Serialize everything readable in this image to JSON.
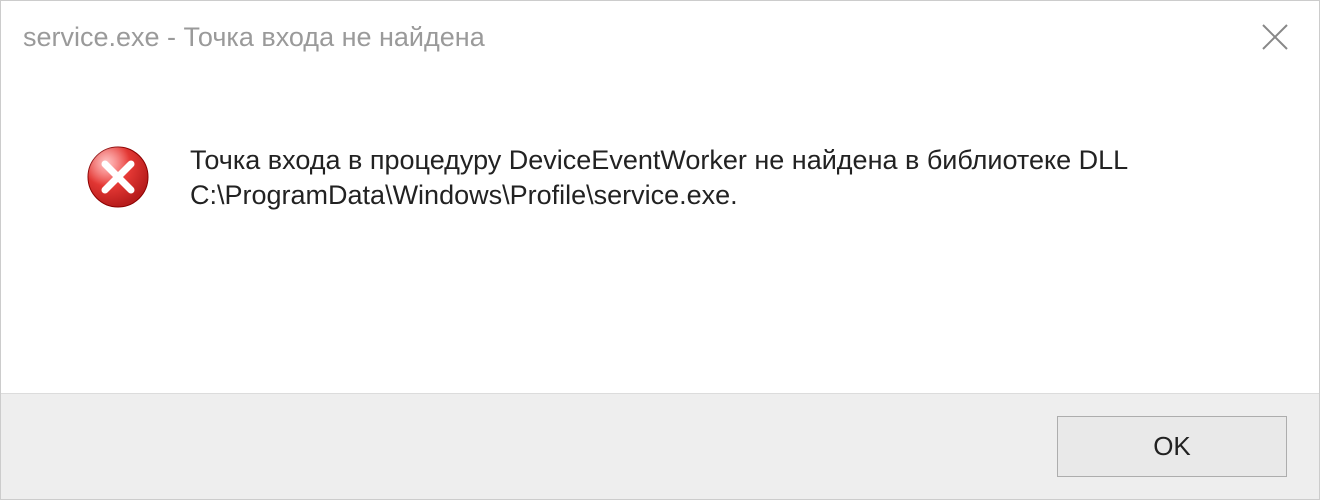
{
  "titlebar": {
    "title": "service.exe - Точка входа не найдена"
  },
  "content": {
    "message": "Точка входа в процедуру DeviceEventWorker не найдена в библиотеке DLL C:\\ProgramData\\Windows\\Profile\\service.exe."
  },
  "buttons": {
    "ok_label": "OK"
  }
}
